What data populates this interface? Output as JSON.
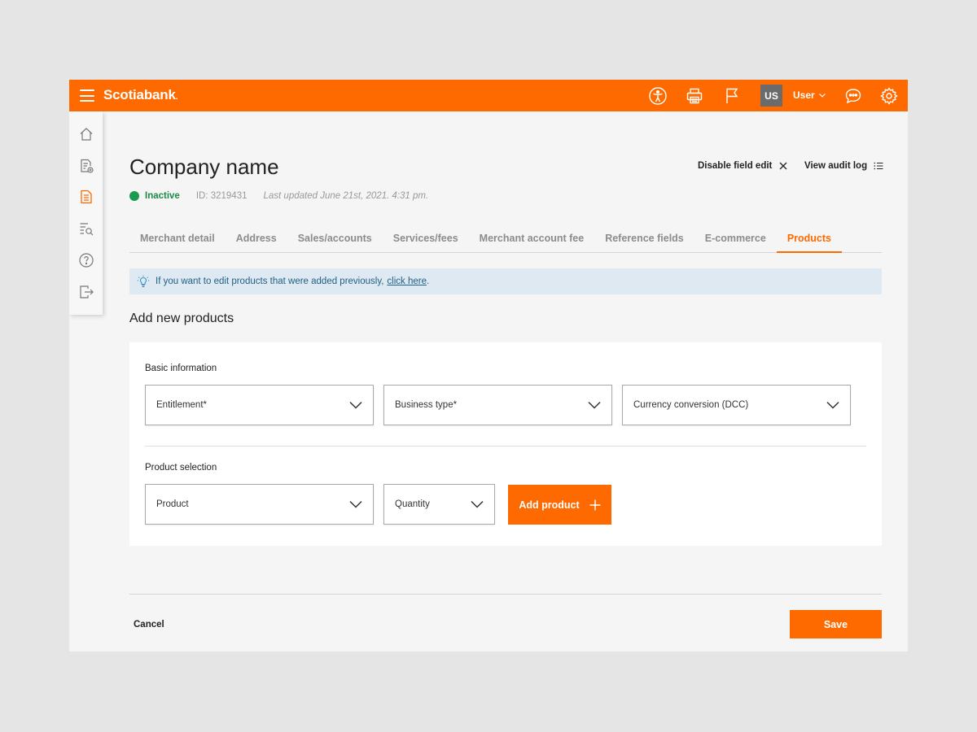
{
  "topbar": {
    "brand": "Scotiabank",
    "brand_mark": ".",
    "avatar_initials": "US",
    "user_label": "User",
    "icons": [
      "hamburger-icon",
      "accessibility-icon",
      "print-icon",
      "flag-icon",
      "chevron-down-icon",
      "chat-icon",
      "gear-icon"
    ]
  },
  "sidebar": {
    "items": [
      "home-icon",
      "document-add-icon",
      "document-icon",
      "list-search-icon",
      "help-icon",
      "logout-icon"
    ],
    "active": "document-icon"
  },
  "header": {
    "title": "Company name",
    "disable_edit_label": "Disable field edit",
    "audit_log_label": "View audit log",
    "status": "Inactive",
    "id_text": "ID: 3219431",
    "updated_text": "Last updated June 21st, 2021. 4:31 pm."
  },
  "tabs": [
    {
      "label": "Merchant detail"
    },
    {
      "label": "Address"
    },
    {
      "label": "Sales/accounts"
    },
    {
      "label": "Services/fees"
    },
    {
      "label": "Merchant account fee"
    },
    {
      "label": "Reference fields"
    },
    {
      "label": "E-commerce"
    },
    {
      "label": "Products",
      "active": true
    }
  ],
  "banner": {
    "text": "If you want to edit products that were added previously,",
    "link": "click here",
    "suffix": "."
  },
  "section_title": "Add new products",
  "basic_info": {
    "label": "Basic information",
    "entitlement": "Entitlement*",
    "business_type": "Business type*",
    "currency": "Currency conversion (DCC)"
  },
  "product_selection": {
    "label": "Product selection",
    "product": "Product",
    "quantity": "Quantity",
    "add_label": "Add product"
  },
  "footer": {
    "cancel_label": "Cancel",
    "save_label": "Save"
  },
  "colors": {
    "brand": "#ff6a00",
    "status_inactive": "#1a9b4f",
    "banner_bg": "#dfe9f1",
    "banner_text": "#1e5f86"
  }
}
